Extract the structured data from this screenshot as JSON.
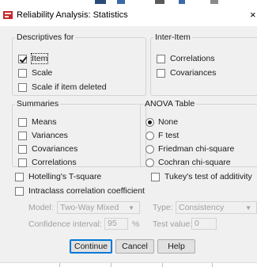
{
  "window": {
    "title": "Reliability Analysis: Statistics",
    "close_label": "×"
  },
  "descriptives": {
    "legend": "Descriptives for",
    "items": [
      {
        "label": "Item",
        "checked": true
      },
      {
        "label": "Scale",
        "checked": false
      },
      {
        "label": "Scale if item deleted",
        "checked": false
      }
    ]
  },
  "inter_item": {
    "legend": "Inter-Item",
    "items": [
      {
        "label": "Correlations",
        "checked": false
      },
      {
        "label": "Covariances",
        "checked": false
      }
    ]
  },
  "summaries": {
    "legend": "Summaries",
    "items": [
      {
        "label": "Means",
        "checked": false
      },
      {
        "label": "Variances",
        "checked": false
      },
      {
        "label": "Covariances",
        "checked": false
      },
      {
        "label": "Correlations",
        "checked": false
      }
    ]
  },
  "anova": {
    "legend": "ANOVA Table",
    "options": [
      {
        "label": "None",
        "selected": true
      },
      {
        "label": "F test",
        "selected": false
      },
      {
        "label": "Friedman chi-square",
        "selected": false
      },
      {
        "label": "Cochran chi-square",
        "selected": false
      }
    ]
  },
  "extras": {
    "hotelling": {
      "label": "Hotelling's T-square",
      "checked": false
    },
    "tukey": {
      "label": "Tukey's test of additivity",
      "checked": false
    },
    "intraclass": {
      "label": "Intraclass correlation coefficient",
      "checked": false
    }
  },
  "icc": {
    "model_label": "Model:",
    "model_value": "Two-Way Mixed",
    "type_label": "Type:",
    "type_value": "Consistency",
    "confidence_label": "Confidence interval:",
    "confidence_value": "95",
    "percent_sign": "%",
    "test_value_label": "Test value:",
    "test_value": "0"
  },
  "buttons": {
    "continue": "Continue",
    "cancel": "Cancel",
    "help": "Help"
  },
  "colors": {
    "window_bg": "#f0f0f0",
    "default_button_border": "#0078d7",
    "disabled_text": "#a0a0a0"
  }
}
